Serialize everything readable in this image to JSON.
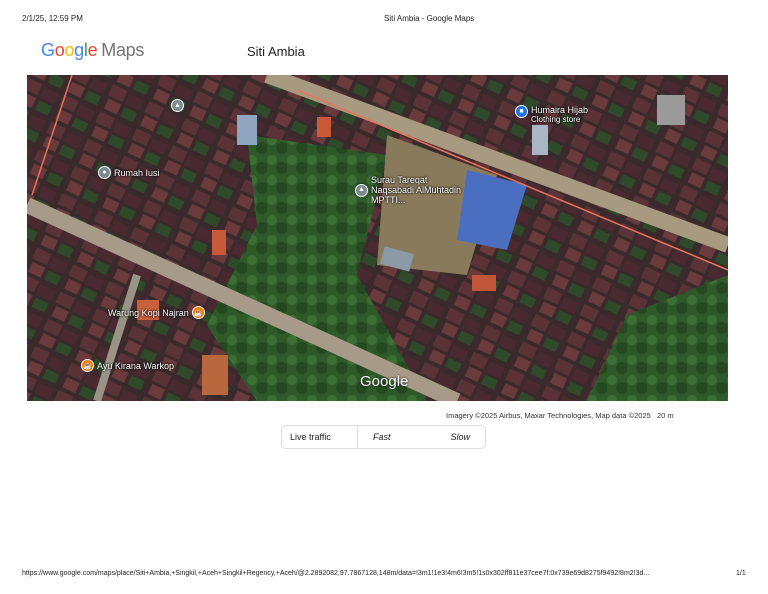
{
  "print_header": {
    "datetime": "2/1/25, 12:59 PM",
    "page_title": "Siti Ambia - Google Maps"
  },
  "logo": {
    "google": "Google",
    "maps": "Maps"
  },
  "place_title": "Siti Ambia",
  "map": {
    "places": [
      {
        "name": "Rumah Iusi",
        "icon": "place-pin-icon"
      },
      {
        "name": "Surau Tareqat Naqsabadi AlMuhtadin MPTTI...",
        "icon": "school-icon"
      },
      {
        "name": "Humaira Hijab",
        "category": "Clothing store",
        "icon": "shopping-bag-icon"
      },
      {
        "name": "Warung Kopi Najran",
        "icon": "cafe-icon"
      },
      {
        "name": "Ayu Kirana Warkop",
        "icon": "cafe-icon"
      }
    ],
    "watermark": "Google",
    "attribution": "Imagery ©2025 Airbus, Maxar Technologies, Map data ©2025",
    "scale": "20 m"
  },
  "traffic_legend": {
    "label": "Live traffic",
    "fast": "Fast",
    "slow": "Slow"
  },
  "print_footer": {
    "url": "https://www.google.com/maps/place/Siti+Ambia,+Singkil,+Aceh+Singkil+Regency,+Aceh/@2.2892082,97.7867128,148m/data=!3m1!1e3!4m6!3m5!1s0x302ff811e37cee7f:0x739e69d8275f9492!8m2!3d...",
    "page": "1/1"
  }
}
